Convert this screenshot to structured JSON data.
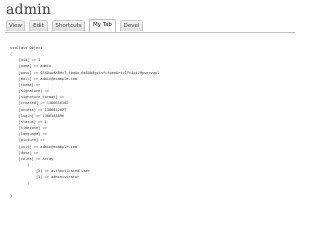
{
  "page": {
    "title": "admin"
  },
  "tabs": [
    {
      "label": "View",
      "active": false
    },
    {
      "label": "Edit",
      "active": false
    },
    {
      "label": "Shortcuts",
      "active": false
    },
    {
      "label": "My Tab",
      "active": true
    },
    {
      "label": "Devel",
      "active": false
    }
  ],
  "dump": {
    "lines": [
      "stdClass Object",
      "(",
      "    [uid] => 1",
      "    [name] => admin",
      "    [pass] => $S$DuwAXBHvT.fbqUo.6mGUb8gzisfcfgeeOrtc1Yc4piJHpuecvgp1",
      "    [mail] => admin@example.com",
      "    [theme] =>",
      "    [signature] =>",
      "    [signature_format] =>",
      "    [created] => 1386616102",
      "    [access] => 1386632077",
      "    [login] => 1386583896",
      "    [status] => 1",
      "    [timezone] =>",
      "    [language] =>",
      "    [picture] =>",
      "    [init] => admin@example.com",
      "    [data] =>",
      "    [roles] => Array",
      "        (",
      "            [2] => authenticated user",
      "            [3] => administrator",
      "        )",
      "",
      ")"
    ]
  }
}
